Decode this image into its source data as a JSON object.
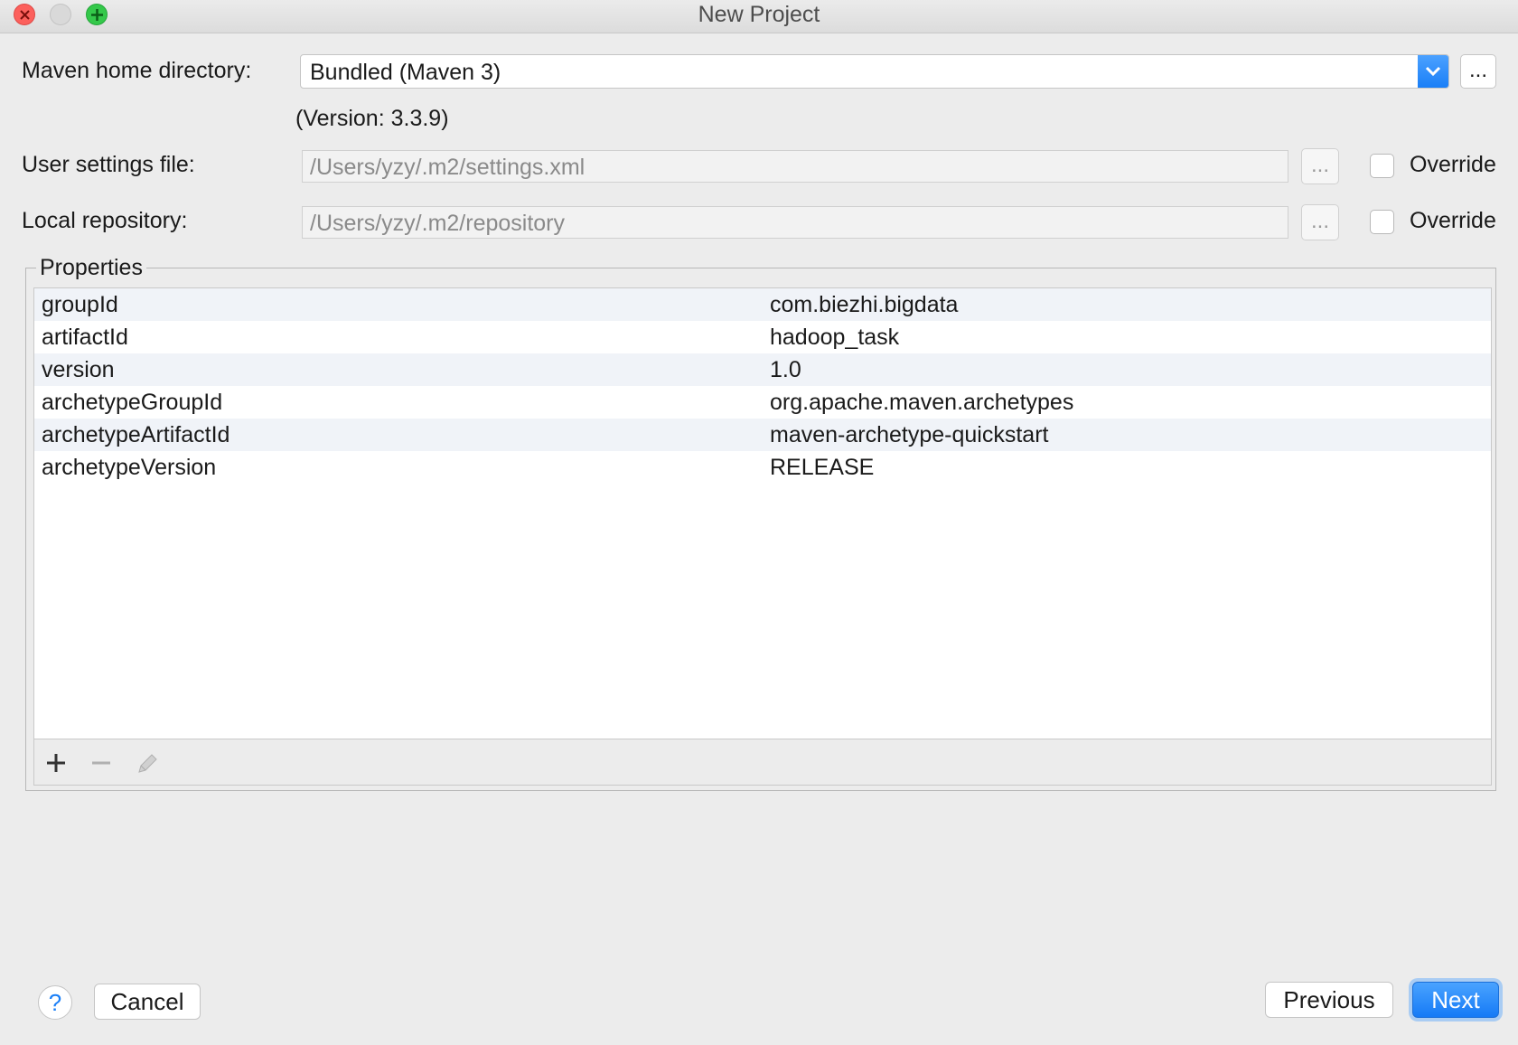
{
  "window": {
    "title": "New Project"
  },
  "maven": {
    "home_label": "Maven home directory:",
    "home_value": "Bundled (Maven 3)",
    "browse_label": "...",
    "version_text": "(Version: 3.3.9)"
  },
  "user_settings": {
    "label": "User settings file:",
    "value": "/Users/yzy/.m2/settings.xml",
    "browse_label": "...",
    "override_label": "Override"
  },
  "local_repo": {
    "label": "Local repository:",
    "value": "/Users/yzy/.m2/repository",
    "browse_label": "...",
    "override_label": "Override"
  },
  "properties": {
    "title": "Properties",
    "rows": [
      {
        "key": "groupId",
        "value": "com.biezhi.bigdata"
      },
      {
        "key": "artifactId",
        "value": "hadoop_task"
      },
      {
        "key": "version",
        "value": "1.0"
      },
      {
        "key": "archetypeGroupId",
        "value": "org.apache.maven.archetypes"
      },
      {
        "key": "archetypeArtifactId",
        "value": "maven-archetype-quickstart"
      },
      {
        "key": "archetypeVersion",
        "value": "RELEASE"
      }
    ]
  },
  "footer": {
    "help_label": "?",
    "cancel_label": "Cancel",
    "previous_label": "Previous",
    "next_label": "Next"
  },
  "icons": {
    "close": "close-icon",
    "minimize": "minimize-icon",
    "zoom": "zoom-icon",
    "dropdown": "chevron-down-icon",
    "add": "plus-icon",
    "remove": "minus-icon",
    "edit": "pencil-icon"
  },
  "colors": {
    "accent": "#1a7ff7",
    "close": "#fc605c",
    "zoom": "#34c84a"
  }
}
